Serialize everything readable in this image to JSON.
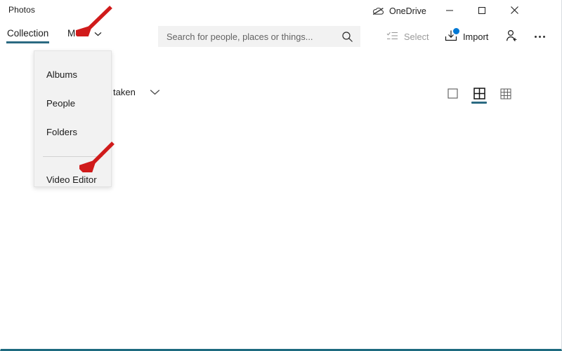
{
  "window": {
    "app_title": "Photos",
    "accent_color": "#2b6a82",
    "badge_color": "#0078d4",
    "annotation_color": "#d01b1b",
    "flyout_bg": "#f2f2f2",
    "search_bg": "#f2f2f2"
  },
  "title_bar": {
    "onedrive": {
      "label": "OneDrive",
      "icon": "cloud-off-icon"
    },
    "caption_buttons": [
      {
        "name": "minimize",
        "icon": "minimize-icon",
        "tooltip": "Minimize"
      },
      {
        "name": "maximize",
        "icon": "maximize-icon",
        "tooltip": "Maximize"
      },
      {
        "name": "close",
        "icon": "close-icon",
        "tooltip": "Close"
      }
    ]
  },
  "command_bar": {
    "tabs": [
      {
        "label": "Collection",
        "selected": true
      },
      {
        "label": "More",
        "selected": false,
        "icon": "chevron-down-icon",
        "expanded": true
      }
    ],
    "search": {
      "placeholder": "Search for people, places or things...",
      "value": "",
      "icon": "search-icon"
    },
    "actions": [
      {
        "label": "Select",
        "icon": "select-icon",
        "enabled": false
      },
      {
        "label": "Import",
        "icon": "import-icon",
        "enabled": true,
        "badge": true
      },
      {
        "label": "",
        "icon": "add-person-icon",
        "enabled": true
      },
      {
        "label": "",
        "icon": "more-options-icon",
        "enabled": true
      }
    ]
  },
  "sort_bar": {
    "sort_label": "taken",
    "sort_icon": "chevron-down-icon",
    "zoom_levels": [
      {
        "name": "zoom-large",
        "icon": "single-tile-icon",
        "selected": false
      },
      {
        "name": "zoom-medium",
        "icon": "grid-2x2-icon",
        "selected": true
      },
      {
        "name": "zoom-small",
        "icon": "grid-3x3-icon",
        "selected": false
      }
    ]
  },
  "more_flyout": {
    "items": [
      {
        "label": "Albums"
      },
      {
        "label": "People"
      },
      {
        "label": "Folders"
      },
      {
        "label": "Video Editor"
      }
    ]
  },
  "annotations": [
    {
      "name": "arrow-more",
      "points_to": "More"
    },
    {
      "name": "arrow-video-editor",
      "points_to": "Video Editor"
    }
  ]
}
